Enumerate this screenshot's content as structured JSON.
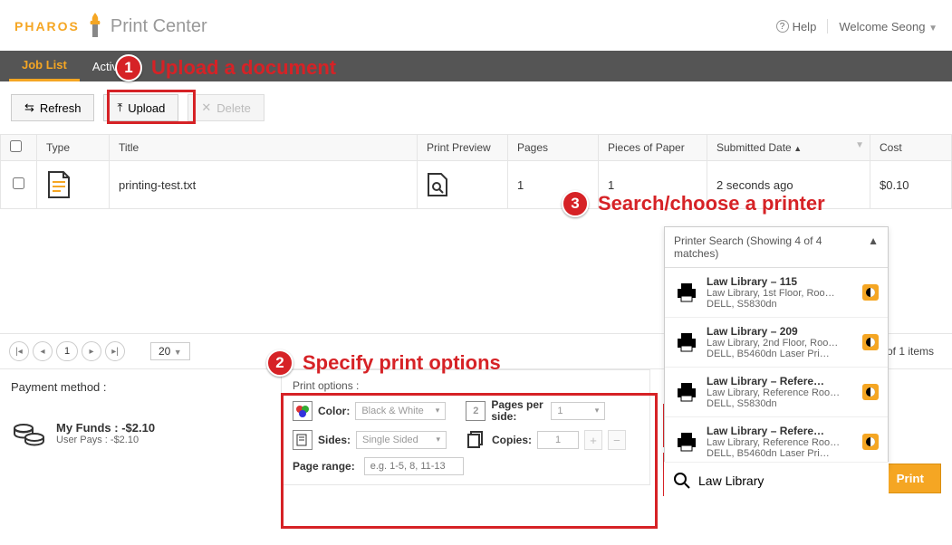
{
  "brand": {
    "logo": "PHAROS",
    "subtitle": "Print Center"
  },
  "header": {
    "help": "Help",
    "welcome": "Welcome Seong"
  },
  "tabs": {
    "job_list": "Job List",
    "activity": "Activ"
  },
  "toolbar": {
    "refresh": "Refresh",
    "upload": "Upload",
    "delete": "Delete"
  },
  "columns": {
    "type": "Type",
    "title": "Title",
    "preview": "Print Preview",
    "pages": "Pages",
    "pieces": "Pieces of Paper",
    "submitted": "Submitted Date",
    "cost": "Cost"
  },
  "rows": [
    {
      "title": "printing-test.txt",
      "pages": "1",
      "pieces": "1",
      "submitted": "2 seconds ago",
      "cost": "$0.10"
    }
  ],
  "pager": {
    "current": "1",
    "page_size": "20",
    "items": "1 of 1 items"
  },
  "payment": {
    "label": "Payment method :",
    "funds_label": "My Funds : ",
    "funds_value": "-$2.10",
    "user_pays_label": "User Pays : ",
    "user_pays_value": "-$2.10"
  },
  "options": {
    "title": "Print options :",
    "color_label": "Color:",
    "color_value": "Black & White",
    "pps_label": "Pages per side:",
    "pps_value": "1",
    "sides_label": "Sides:",
    "sides_value": "Single Sided",
    "copies_label": "Copies:",
    "copies_value": "1",
    "range_label": "Page range:",
    "range_placeholder": "e.g. 1-5, 8, 11-13"
  },
  "printer": {
    "head": "Printer Search (Showing 4 of 4 matches)",
    "items": [
      {
        "name": "Law Library – 115",
        "loc": "Law Library, 1st Floor, Roo…",
        "model": "DELL, S5830dn"
      },
      {
        "name": "Law Library – 209",
        "loc": "Law Library, 2nd Floor, Roo…",
        "model": "DELL, B5460dn Laser Pri…"
      },
      {
        "name": "Law Library – Refere…",
        "loc": "Law Library, Reference Roo…",
        "model": "DELL, S5830dn"
      },
      {
        "name": "Law Library – Refere…",
        "loc": "Law Library, Reference Roo…",
        "model": "DELL, B5460dn Laser Pri…"
      }
    ],
    "search_value": "Law Library",
    "print_button": "Print"
  },
  "callouts": {
    "c1": "Upload a document",
    "c2": "Specify print options",
    "c3": "Search/choose a printer"
  }
}
